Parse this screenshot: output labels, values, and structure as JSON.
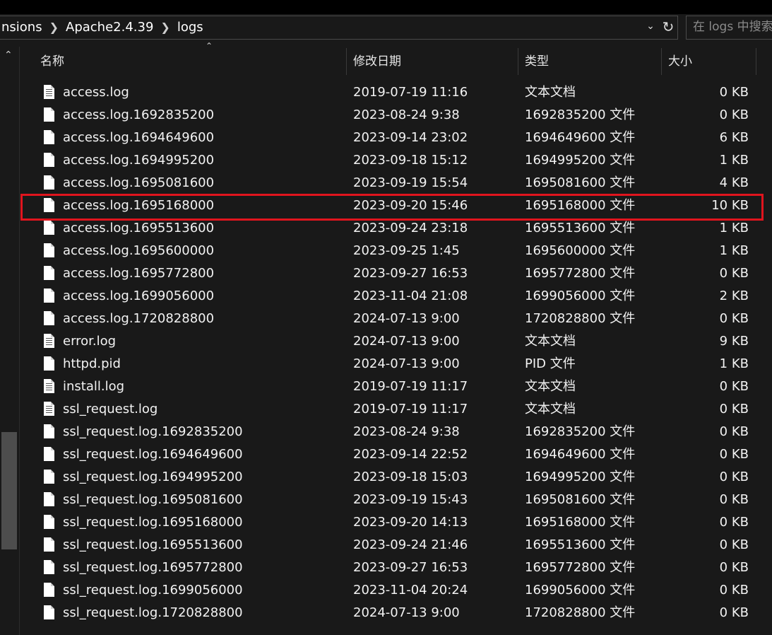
{
  "breadcrumb": [
    "nsions",
    "Apache2.4.39",
    "logs"
  ],
  "search": {
    "placeholder": "在 logs 中搜索"
  },
  "columns": {
    "name": "名称",
    "date": "修改日期",
    "type": "类型",
    "size": "大小"
  },
  "colors": {
    "highlight": "#e0141e",
    "background": "#191919"
  },
  "highlighted_row": "access.log.1695168000",
  "files": [
    {
      "name": "access.log",
      "date": "2019-07-19 11:16",
      "type": "文本文档",
      "size": "0 KB",
      "icon": "text-document-icon"
    },
    {
      "name": "access.log.1692835200",
      "date": "2023-08-24 9:38",
      "type": "1692835200 文件",
      "size": "0 KB",
      "icon": "file-icon"
    },
    {
      "name": "access.log.1694649600",
      "date": "2023-09-14 23:02",
      "type": "1694649600 文件",
      "size": "6 KB",
      "icon": "file-icon"
    },
    {
      "name": "access.log.1694995200",
      "date": "2023-09-18 15:12",
      "type": "1694995200 文件",
      "size": "1 KB",
      "icon": "file-icon"
    },
    {
      "name": "access.log.1695081600",
      "date": "2023-09-19 15:54",
      "type": "1695081600 文件",
      "size": "4 KB",
      "icon": "file-icon"
    },
    {
      "name": "access.log.1695168000",
      "date": "2023-09-20 15:46",
      "type": "1695168000 文件",
      "size": "10 KB",
      "icon": "file-icon"
    },
    {
      "name": "access.log.1695513600",
      "date": "2023-09-24 23:18",
      "type": "1695513600 文件",
      "size": "1 KB",
      "icon": "file-icon"
    },
    {
      "name": "access.log.1695600000",
      "date": "2023-09-25 1:45",
      "type": "1695600000 文件",
      "size": "1 KB",
      "icon": "file-icon"
    },
    {
      "name": "access.log.1695772800",
      "date": "2023-09-27 16:53",
      "type": "1695772800 文件",
      "size": "0 KB",
      "icon": "file-icon"
    },
    {
      "name": "access.log.1699056000",
      "date": "2023-11-04 21:08",
      "type": "1699056000 文件",
      "size": "2 KB",
      "icon": "file-icon"
    },
    {
      "name": "access.log.1720828800",
      "date": "2024-07-13 9:00",
      "type": "1720828800 文件",
      "size": "0 KB",
      "icon": "file-icon"
    },
    {
      "name": "error.log",
      "date": "2024-07-13 9:00",
      "type": "文本文档",
      "size": "9 KB",
      "icon": "text-document-icon"
    },
    {
      "name": "httpd.pid",
      "date": "2024-07-13 9:00",
      "type": "PID 文件",
      "size": "1 KB",
      "icon": "file-icon"
    },
    {
      "name": "install.log",
      "date": "2019-07-19 11:17",
      "type": "文本文档",
      "size": "0 KB",
      "icon": "text-document-icon"
    },
    {
      "name": "ssl_request.log",
      "date": "2019-07-19 11:17",
      "type": "文本文档",
      "size": "0 KB",
      "icon": "text-document-icon"
    },
    {
      "name": "ssl_request.log.1692835200",
      "date": "2023-08-24 9:38",
      "type": "1692835200 文件",
      "size": "0 KB",
      "icon": "file-icon"
    },
    {
      "name": "ssl_request.log.1694649600",
      "date": "2023-09-14 22:52",
      "type": "1694649600 文件",
      "size": "0 KB",
      "icon": "file-icon"
    },
    {
      "name": "ssl_request.log.1694995200",
      "date": "2023-09-18 15:03",
      "type": "1694995200 文件",
      "size": "0 KB",
      "icon": "file-icon"
    },
    {
      "name": "ssl_request.log.1695081600",
      "date": "2023-09-19 15:43",
      "type": "1695081600 文件",
      "size": "0 KB",
      "icon": "file-icon"
    },
    {
      "name": "ssl_request.log.1695168000",
      "date": "2023-09-20 14:13",
      "type": "1695168000 文件",
      "size": "0 KB",
      "icon": "file-icon"
    },
    {
      "name": "ssl_request.log.1695513600",
      "date": "2023-09-24 21:46",
      "type": "1695513600 文件",
      "size": "0 KB",
      "icon": "file-icon"
    },
    {
      "name": "ssl_request.log.1695772800",
      "date": "2023-09-27 16:53",
      "type": "1695772800 文件",
      "size": "0 KB",
      "icon": "file-icon"
    },
    {
      "name": "ssl_request.log.1699056000",
      "date": "2023-11-04 20:24",
      "type": "1699056000 文件",
      "size": "0 KB",
      "icon": "file-icon"
    },
    {
      "name": "ssl_request.log.1720828800",
      "date": "2024-07-13 9:00",
      "type": "1720828800 文件",
      "size": "0 KB",
      "icon": "file-icon"
    }
  ]
}
